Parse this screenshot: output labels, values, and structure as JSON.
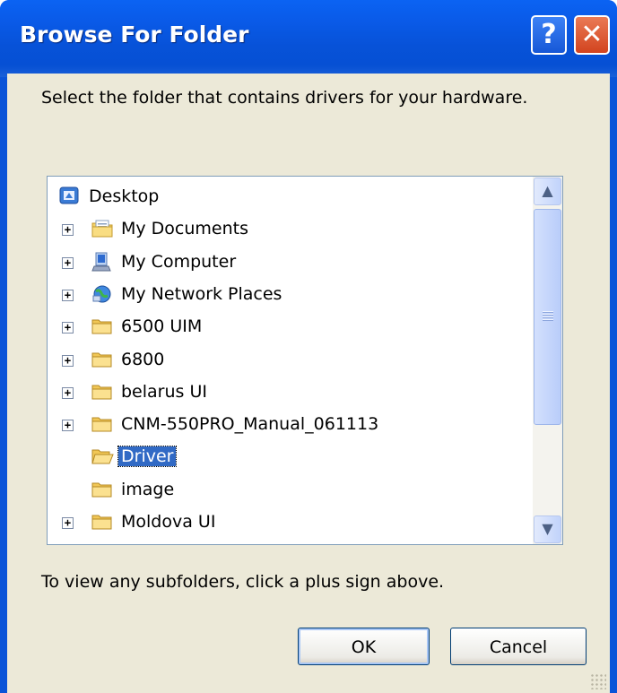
{
  "window": {
    "title": "Browse For Folder",
    "help_glyph": "?",
    "close_glyph": "✕"
  },
  "prompt": "Select the folder that contains drivers for your hardware.",
  "tree": {
    "items": [
      {
        "label": "Desktop",
        "icon": "desktop-icon",
        "expander": ""
      },
      {
        "label": "My Documents",
        "icon": "my-documents-icon",
        "expander": "+"
      },
      {
        "label": "My Computer",
        "icon": "my-computer-icon",
        "expander": "+"
      },
      {
        "label": "My Network Places",
        "icon": "network-places-icon",
        "expander": "+"
      },
      {
        "label": "6500 UIM",
        "icon": "folder-icon",
        "expander": "+"
      },
      {
        "label": "6800",
        "icon": "folder-icon",
        "expander": "+"
      },
      {
        "label": "belarus UI",
        "icon": "folder-icon",
        "expander": "+"
      },
      {
        "label": "CNM-550PRO_Manual_061113",
        "icon": "folder-icon",
        "expander": "+"
      },
      {
        "label": "Driver",
        "icon": "folder-open-icon",
        "expander": "",
        "selected": true
      },
      {
        "label": "image",
        "icon": "folder-icon",
        "expander": ""
      },
      {
        "label": "Moldova UI",
        "icon": "folder-icon",
        "expander": "+"
      }
    ],
    "scroll_up_glyph": "▲",
    "scroll_down_glyph": "▼"
  },
  "hint": "To view any subfolders, click a plus sign above.",
  "buttons": {
    "ok": "OK",
    "cancel": "Cancel"
  },
  "colors": {
    "titlebar": "#0a5be9",
    "selection": "#316ac5",
    "client": "#ece9d8"
  }
}
